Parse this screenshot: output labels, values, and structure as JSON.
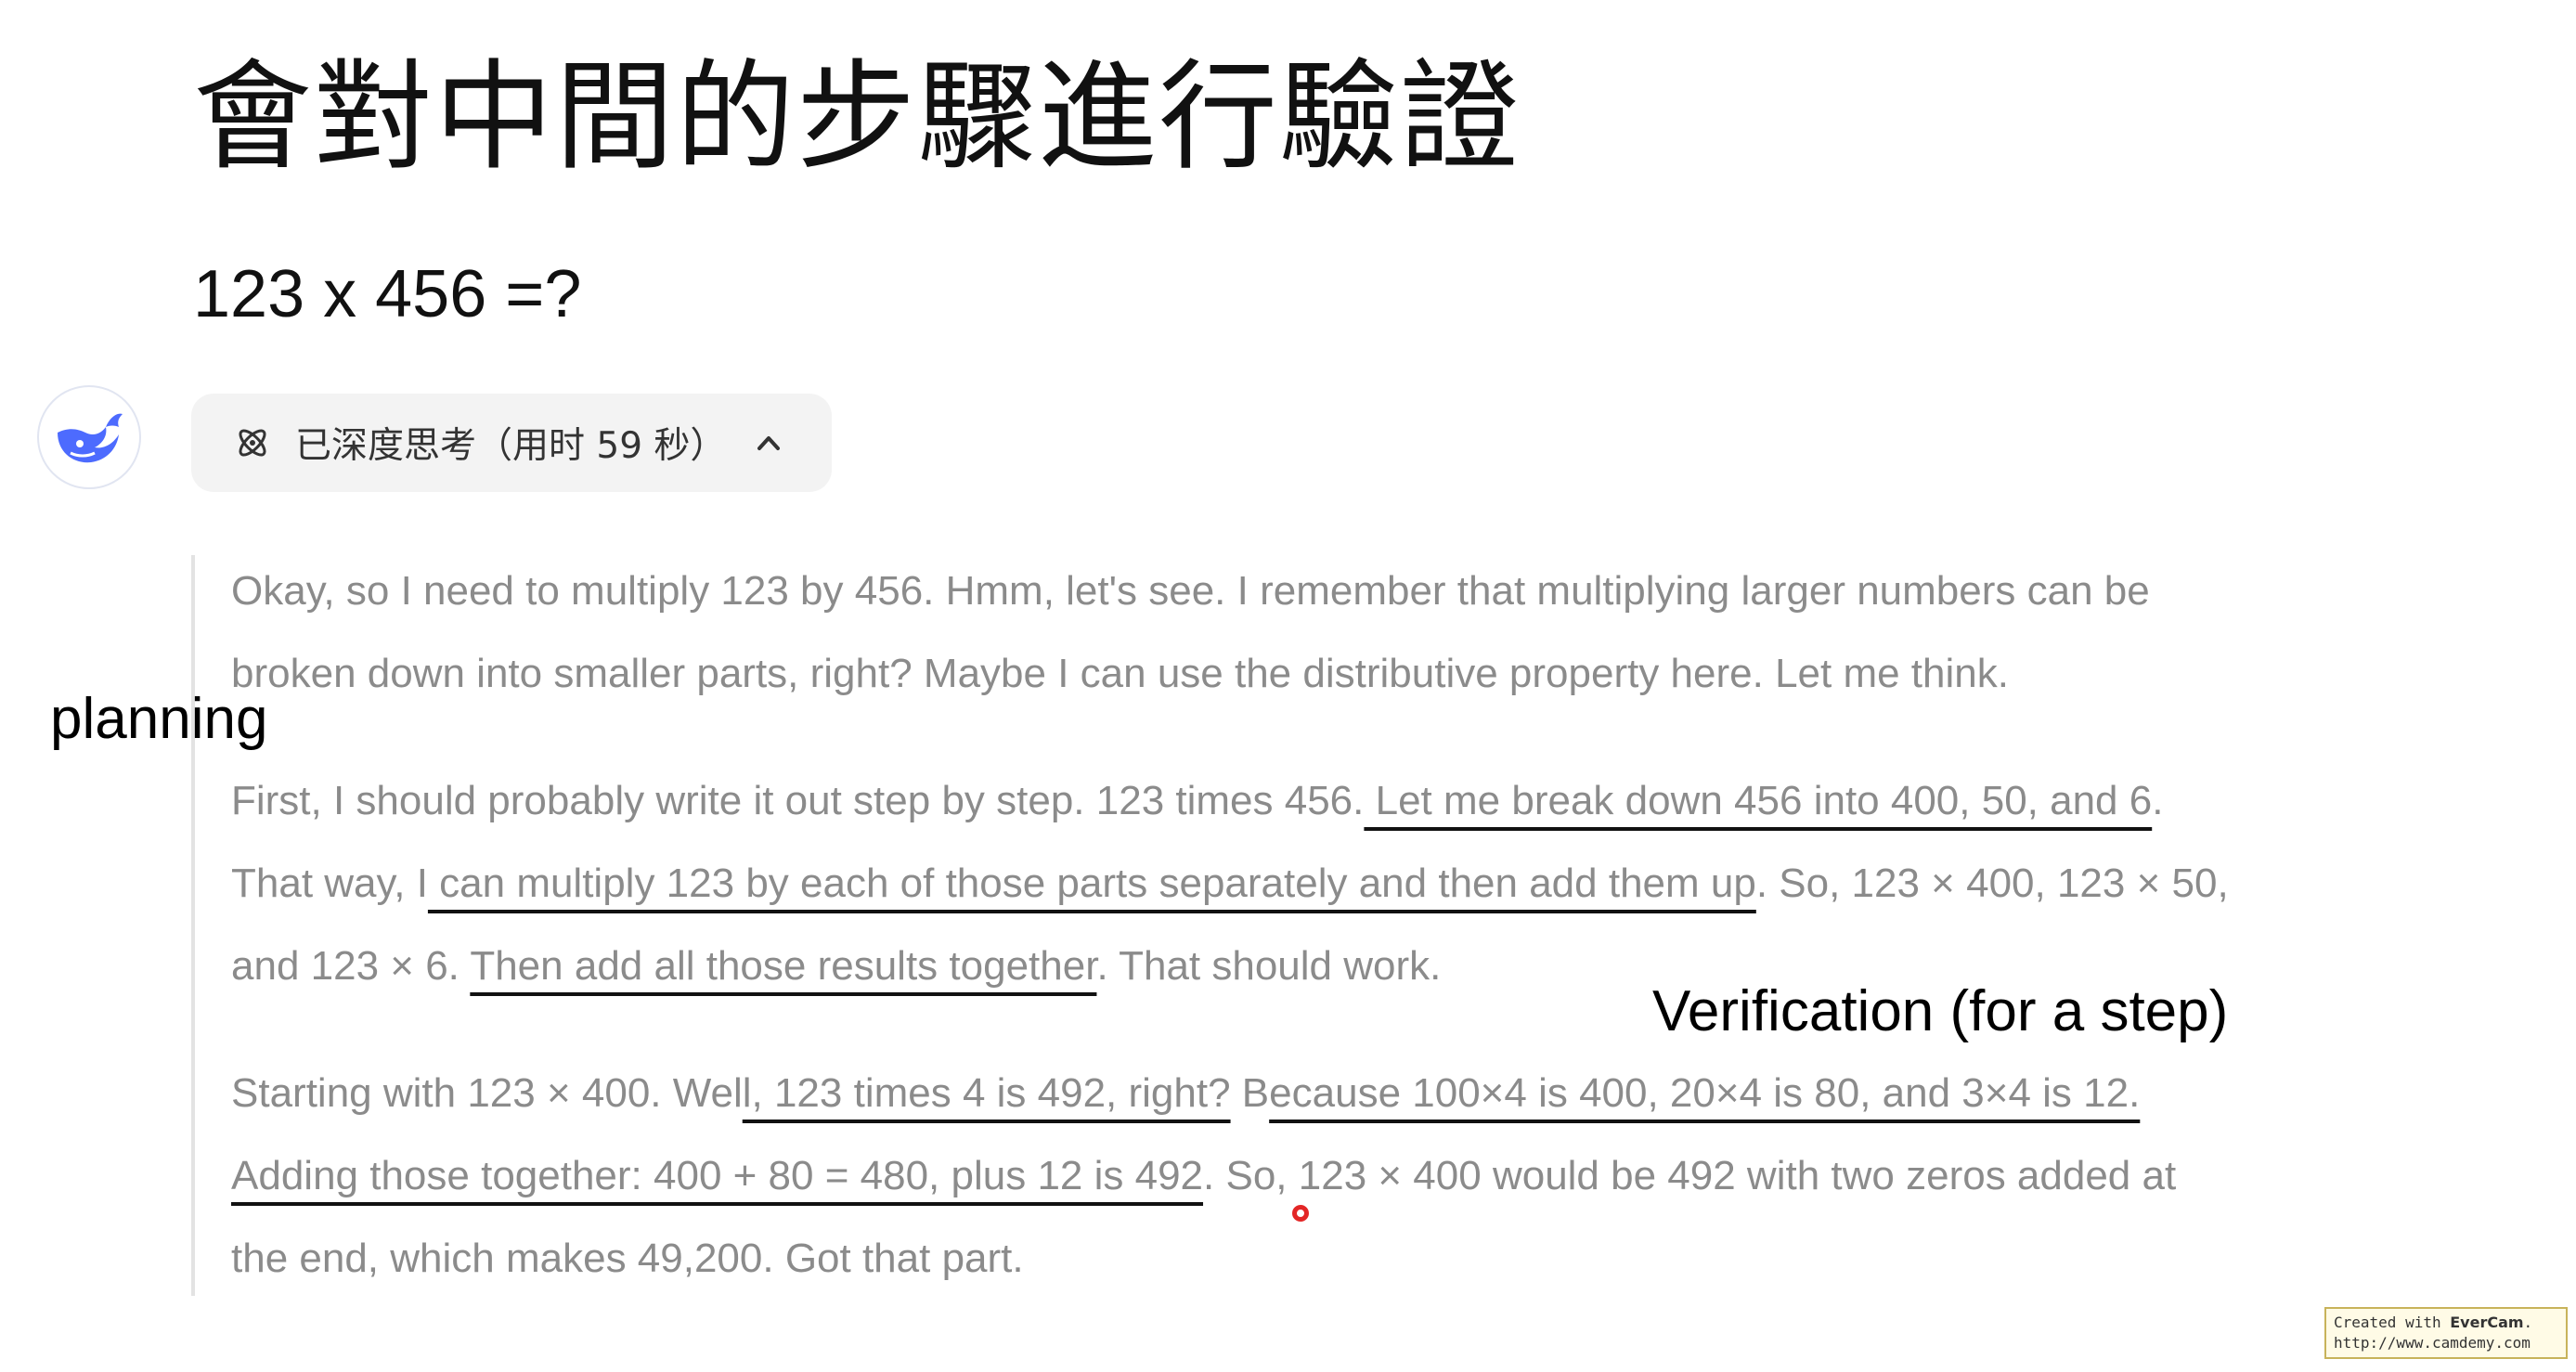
{
  "slide": {
    "title": "會對中間的步驟進行驗證",
    "question": "123 x 456 =?"
  },
  "chat": {
    "thinking_label": "已深度思考（用时 59 秒）",
    "thinking": {
      "p1": [
        "Okay, so I need to multiply 123 by 456. Hmm, let's see. I remember that multiplying larger numbers can be",
        "broken down into smaller parts, right? Maybe I can use the distributive property here. Let me think."
      ],
      "p2": {
        "l1a": "First, I should probably write it out step by step. 123 times 456.",
        "l1b": " Let me break down 456 into 400, 50, and 6",
        "l1c": ".",
        "l2a": "That way, I",
        "l2b": " can multiply 123 by each of those parts separately and then add them up",
        "l2c": ". So, 123 × 400, 123 × 50,",
        "l3a": "and 123 × 6. ",
        "l3b": "Then add all those results together",
        "l3c": ". That should work."
      },
      "p3": {
        "l1a": "Starting with 123 × 400. Wel",
        "l1b": "l, 123 times 4 is 492, right?",
        "l1c": " B",
        "l1d": "ecause 100×4 is 400, 20×4 is 80, and 3×4 is 12.  ",
        "l2a": "Adding those together: 400 + 80 = 480, plus 12 is 492",
        "l2b": ". So, 123 × 400 would be 492 with two zeros added at",
        "l3": "the end, which makes 49,200. Got that part."
      }
    }
  },
  "annotations": {
    "planning": "planning",
    "verification": "Verification (for a step)"
  },
  "watermark": {
    "line1_prefix": "Created with ",
    "line1_brand": "EverCam",
    "line1_suffix": ".",
    "line2": "http://www.camdemy.com"
  },
  "icons": {
    "avatar": "deepseek-whale-icon",
    "thinking": "atom-icon",
    "collapse": "chevron-up-icon"
  },
  "colors": {
    "brand_blue": "#4d6bfe",
    "thinking_text": "#8b8b8b",
    "pill_bg": "#f3f3f3"
  }
}
